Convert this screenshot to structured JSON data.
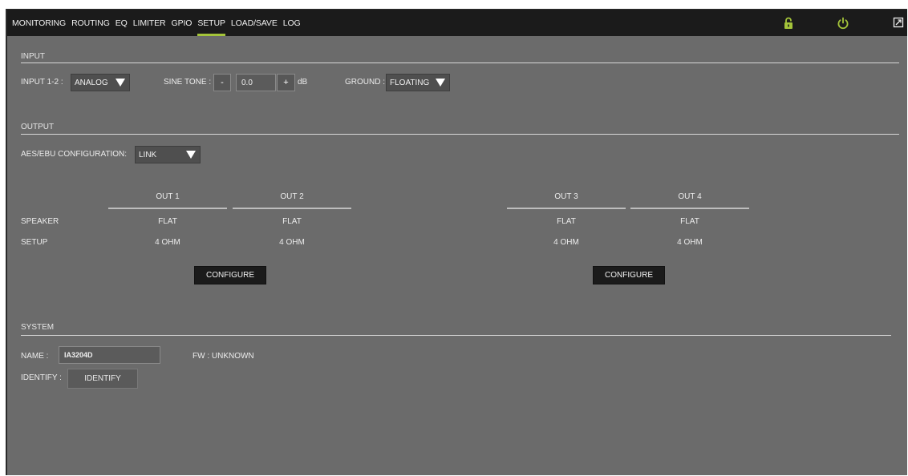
{
  "nav": {
    "items": [
      {
        "label": "MONITORING"
      },
      {
        "label": "ROUTING"
      },
      {
        "label": "EQ"
      },
      {
        "label": "LIMITER"
      },
      {
        "label": "GPIO"
      },
      {
        "label": "SETUP"
      },
      {
        "label": "LOAD/SAVE"
      },
      {
        "label": "LOG"
      }
    ],
    "active": "SETUP",
    "icons": [
      "lock-open-icon",
      "power-icon",
      "fullscreen-icon"
    ],
    "accent_color": "#a4c43a"
  },
  "input": {
    "section_title": "INPUT",
    "input12_label": "INPUT 1-2 :",
    "input12_value": "ANALOG",
    "sine_label": "SINE TONE :",
    "minus_label": "-",
    "sine_value": "0.0",
    "plus_label": "+",
    "sine_unit": "dB",
    "ground_label": "GROUND :",
    "ground_value": "FLOATING"
  },
  "output": {
    "section_title": "OUTPUT",
    "aes_label": "AES/EBU CONFIGURATION:",
    "aes_value": "LINK",
    "row_label_1": "SPEAKER",
    "row_label_2": "SETUP",
    "outs": [
      {
        "name": "OUT 1",
        "speaker": "FLAT",
        "impedance": "4 OHM"
      },
      {
        "name": "OUT 2",
        "speaker": "FLAT",
        "impedance": "4 OHM"
      },
      {
        "name": "OUT 3",
        "speaker": "FLAT",
        "impedance": "4 OHM"
      },
      {
        "name": "OUT 4",
        "speaker": "FLAT",
        "impedance": "4 OHM"
      }
    ],
    "configure_label": "CONFIGURE"
  },
  "system": {
    "section_title": "SYSTEM",
    "name_label": "NAME :",
    "name_value": "IA3204D",
    "fw_label": "FW : UNKNOWN",
    "identify_label": "IDENTIFY :",
    "identify_button": "IDENTIFY"
  }
}
